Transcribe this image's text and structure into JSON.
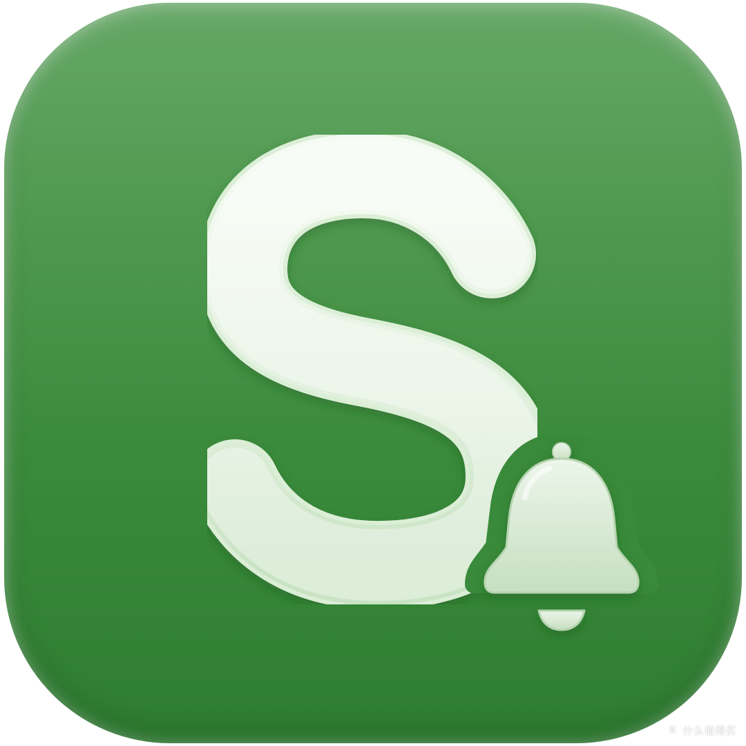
{
  "app_icon": {
    "letter": "S",
    "badge_icon": "bell-icon",
    "background_color": "#3b8b3c",
    "glyph_color": "#e6f3e4"
  },
  "watermark": {
    "badge_glyph": "值",
    "text": "什么值得买"
  }
}
